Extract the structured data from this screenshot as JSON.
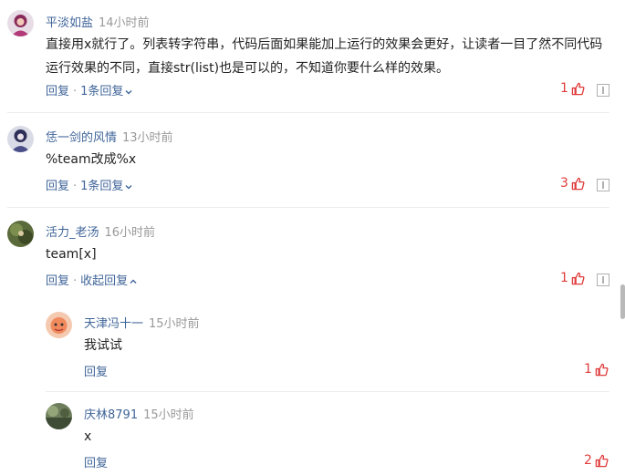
{
  "comments": [
    {
      "author": "平淡如盐",
      "time": "14小时前",
      "content": [
        "直接用x就行了。列表转字符串，代码后面如果能加上运行的效果会更好，让读者一目了然不同代码",
        "运行效果的不同，直接str(list)也是可以的，不知道你要什么样的效果。"
      ],
      "reply_label": "回复",
      "replies_label": "1条回复",
      "likes": "1"
    },
    {
      "author": "恁一剑的风情",
      "time": "13小时前",
      "content": [
        "%team改成%x"
      ],
      "reply_label": "回复",
      "replies_label": "1条回复",
      "likes": "3"
    },
    {
      "author": "活力_老汤",
      "time": "16小时前",
      "content": [
        "team[x]"
      ],
      "reply_label": "回复",
      "replies_label": "收起回复",
      "likes": "1",
      "replies": [
        {
          "author": "天津冯十一",
          "time": "15小时前",
          "content": "我试试",
          "reply_label": "回复",
          "likes": "1"
        },
        {
          "author": "庆林8791",
          "time": "15小时前",
          "content": "x",
          "reply_label": "回复",
          "likes": "2"
        }
      ]
    }
  ],
  "colors": {
    "author": "#406599",
    "time": "#999999",
    "like": "#e03c3c"
  }
}
